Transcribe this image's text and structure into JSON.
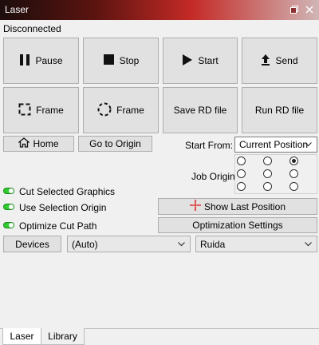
{
  "window": {
    "title": "Laser"
  },
  "status": "Disconnected",
  "controls": {
    "pause": "Pause",
    "stop": "Stop",
    "start": "Start",
    "send": "Send",
    "frame": "Frame",
    "frame_circle": "Frame",
    "save_rd": "Save RD file",
    "run_rd": "Run RD file",
    "home": "Home",
    "go_to_origin": "Go to Origin"
  },
  "start_from": {
    "label": "Start From:",
    "value": "Current Position"
  },
  "job_origin": {
    "label": "Job Origin",
    "selected_index": 2
  },
  "options": [
    {
      "label": "Cut Selected Graphics",
      "enabled": true
    },
    {
      "label": "Use Selection Origin",
      "enabled": true
    },
    {
      "label": "Optimize Cut Path",
      "enabled": true
    }
  ],
  "show_last_position": "Show Last Position",
  "optimization_settings": "Optimization Settings",
  "devices": {
    "button": "Devices",
    "port": "(Auto)",
    "controller": "Ruida"
  },
  "tabs": [
    {
      "label": "Laser",
      "active": true
    },
    {
      "label": "Library",
      "active": false
    }
  ],
  "colors": {
    "toggle_on": "#2ecc2e",
    "accent_red": "#e03030",
    "title_gradient_mid": "#c42a26"
  }
}
